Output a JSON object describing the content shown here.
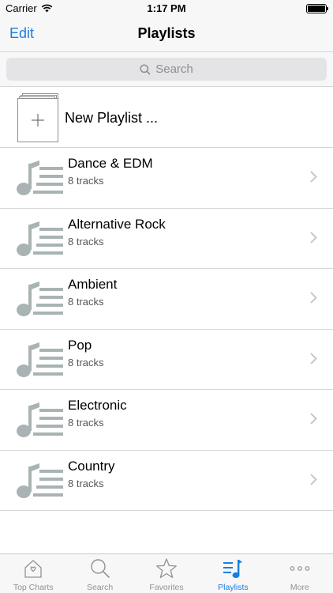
{
  "status_bar": {
    "carrier": "Carrier",
    "time": "1:17 PM"
  },
  "nav": {
    "edit_label": "Edit",
    "title": "Playlists"
  },
  "search": {
    "placeholder": "Search"
  },
  "new_playlist": {
    "label": "New Playlist ..."
  },
  "playlists": [
    {
      "title": "Dance & EDM",
      "subtitle": "8 tracks"
    },
    {
      "title": "Alternative Rock",
      "subtitle": "8 tracks"
    },
    {
      "title": "Ambient",
      "subtitle": "8 tracks"
    },
    {
      "title": "Pop",
      "subtitle": "8 tracks"
    },
    {
      "title": "Electronic",
      "subtitle": "8 tracks"
    },
    {
      "title": "Country",
      "subtitle": "8 tracks"
    }
  ],
  "tabs": [
    {
      "label": "Top Charts",
      "icon": "home-icon",
      "active": false
    },
    {
      "label": "Search",
      "icon": "search-icon",
      "active": false
    },
    {
      "label": "Favorites",
      "icon": "star-icon",
      "active": false
    },
    {
      "label": "Playlists",
      "icon": "playlist-icon",
      "active": true
    },
    {
      "label": "More",
      "icon": "more-icon",
      "active": false
    }
  ],
  "colors": {
    "accent": "#1a7ee0",
    "inactive_tab": "#929292",
    "thumb_gray": "#a9b3b3"
  }
}
